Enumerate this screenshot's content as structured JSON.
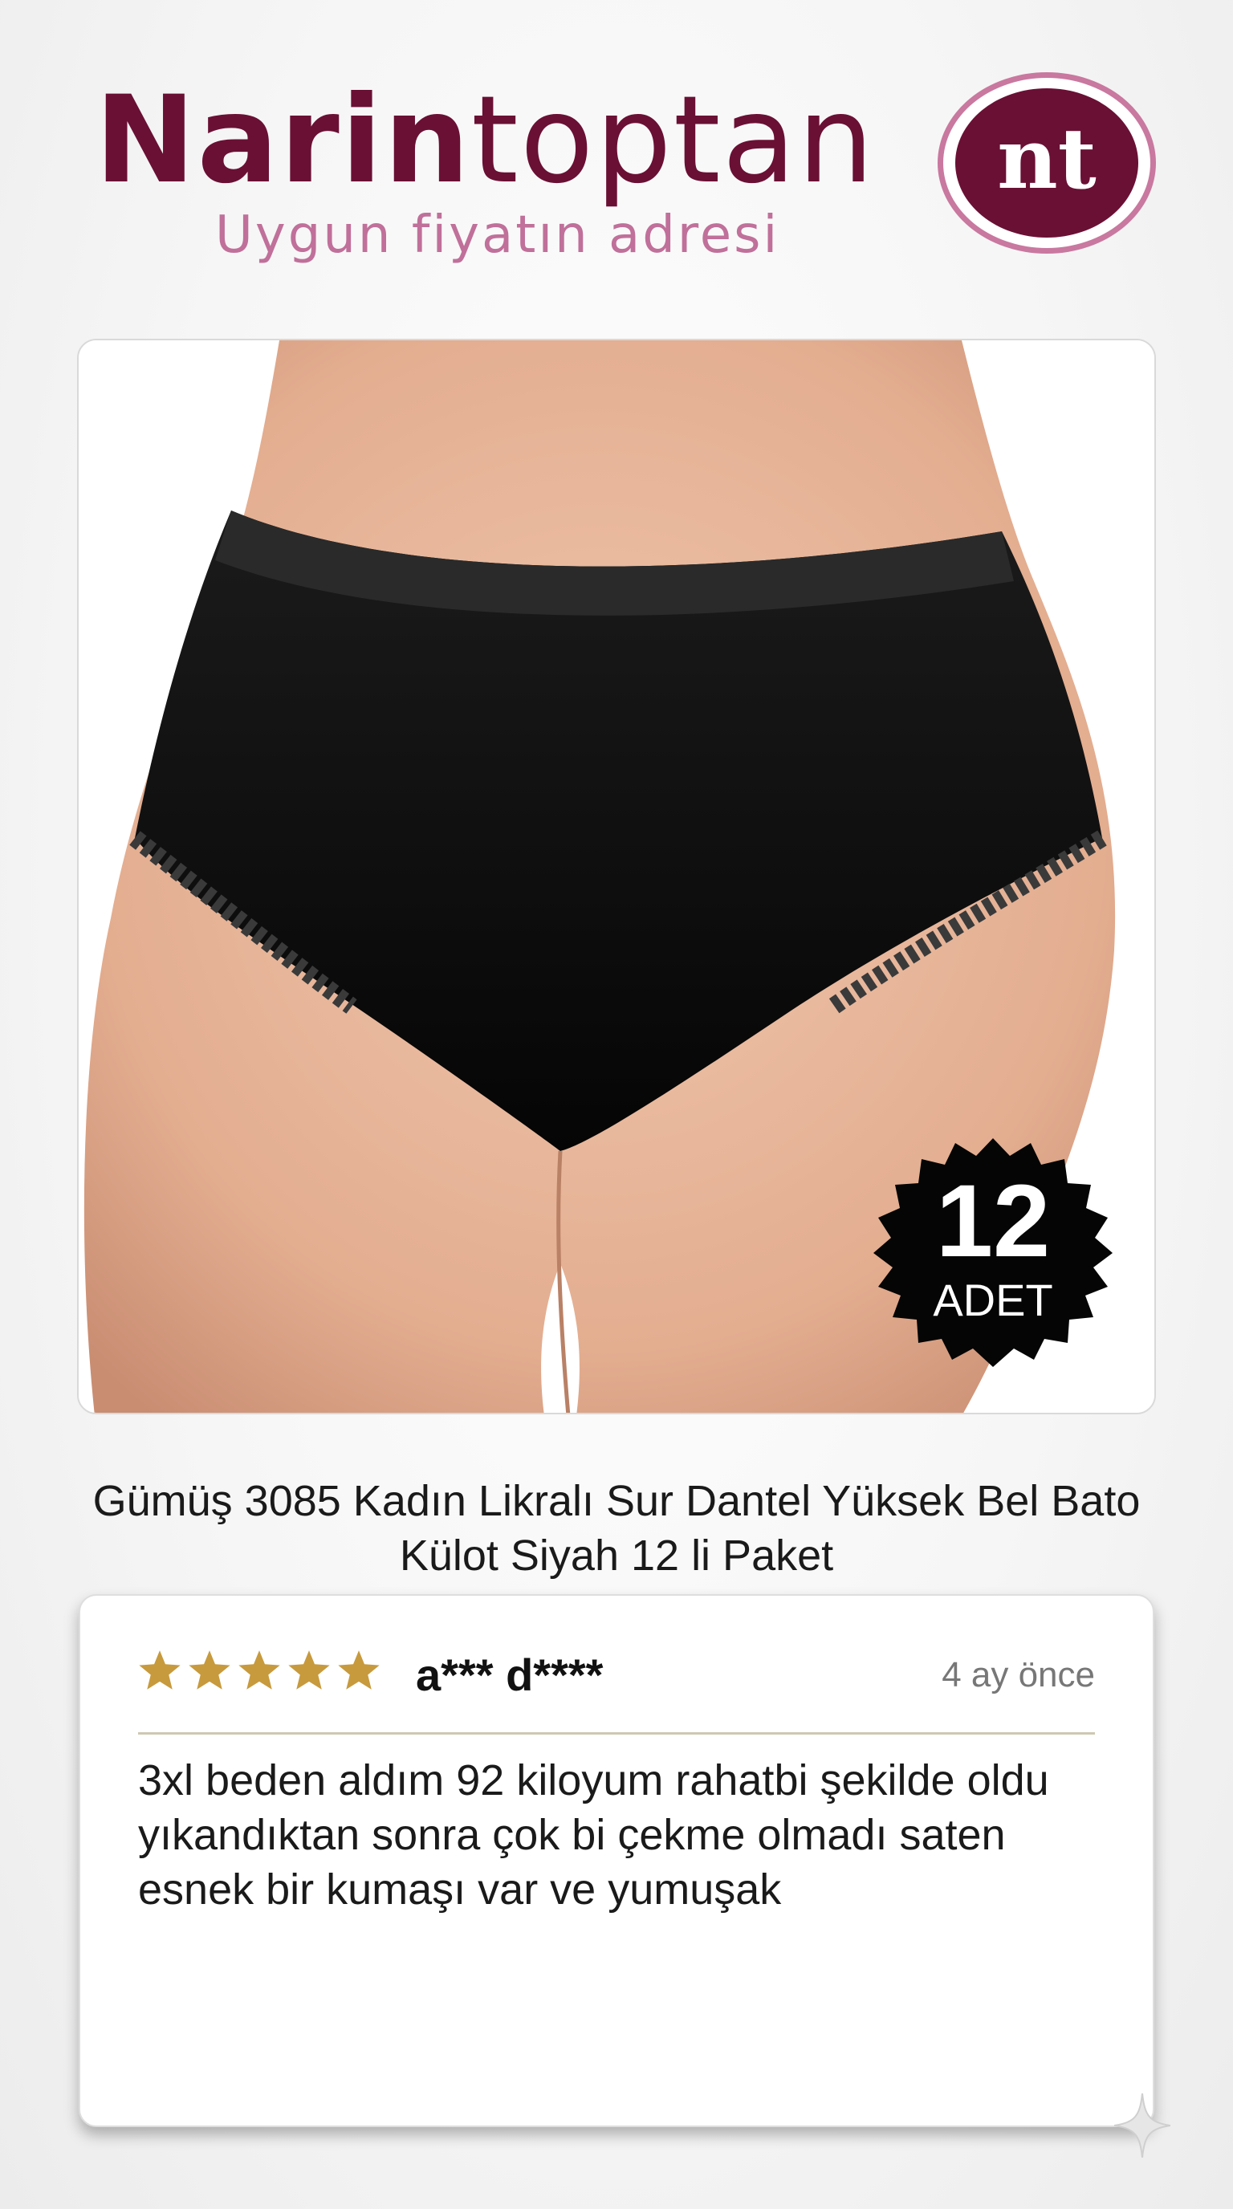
{
  "brand": {
    "name_bold": "Narin",
    "name_thin": "toptan",
    "tagline": "Uygun fiyatın adresi",
    "logo_mark": "nt",
    "colors": {
      "primary": "#6a1034",
      "accent": "#c0709a"
    }
  },
  "product": {
    "image_icon": "product-photo-black-briefs",
    "badge_count": "12",
    "badge_unit": "ADET",
    "title": "Gümüş 3085 Kadın Likralı Sur Dantel Yüksek Bel Bato Külot Siyah 12 li Paket"
  },
  "review": {
    "rating": 5,
    "rating_max": 5,
    "star_color": "#c79a3d",
    "reviewer": "a*** d****",
    "time": "4 ay önce",
    "text": "3xl beden aldım 92 kiloyum rahatbi şekilde oldu yıkandıktan sonra çok bi çekme olmadı saten esnek bir kumaşı var ve yumuşak"
  }
}
